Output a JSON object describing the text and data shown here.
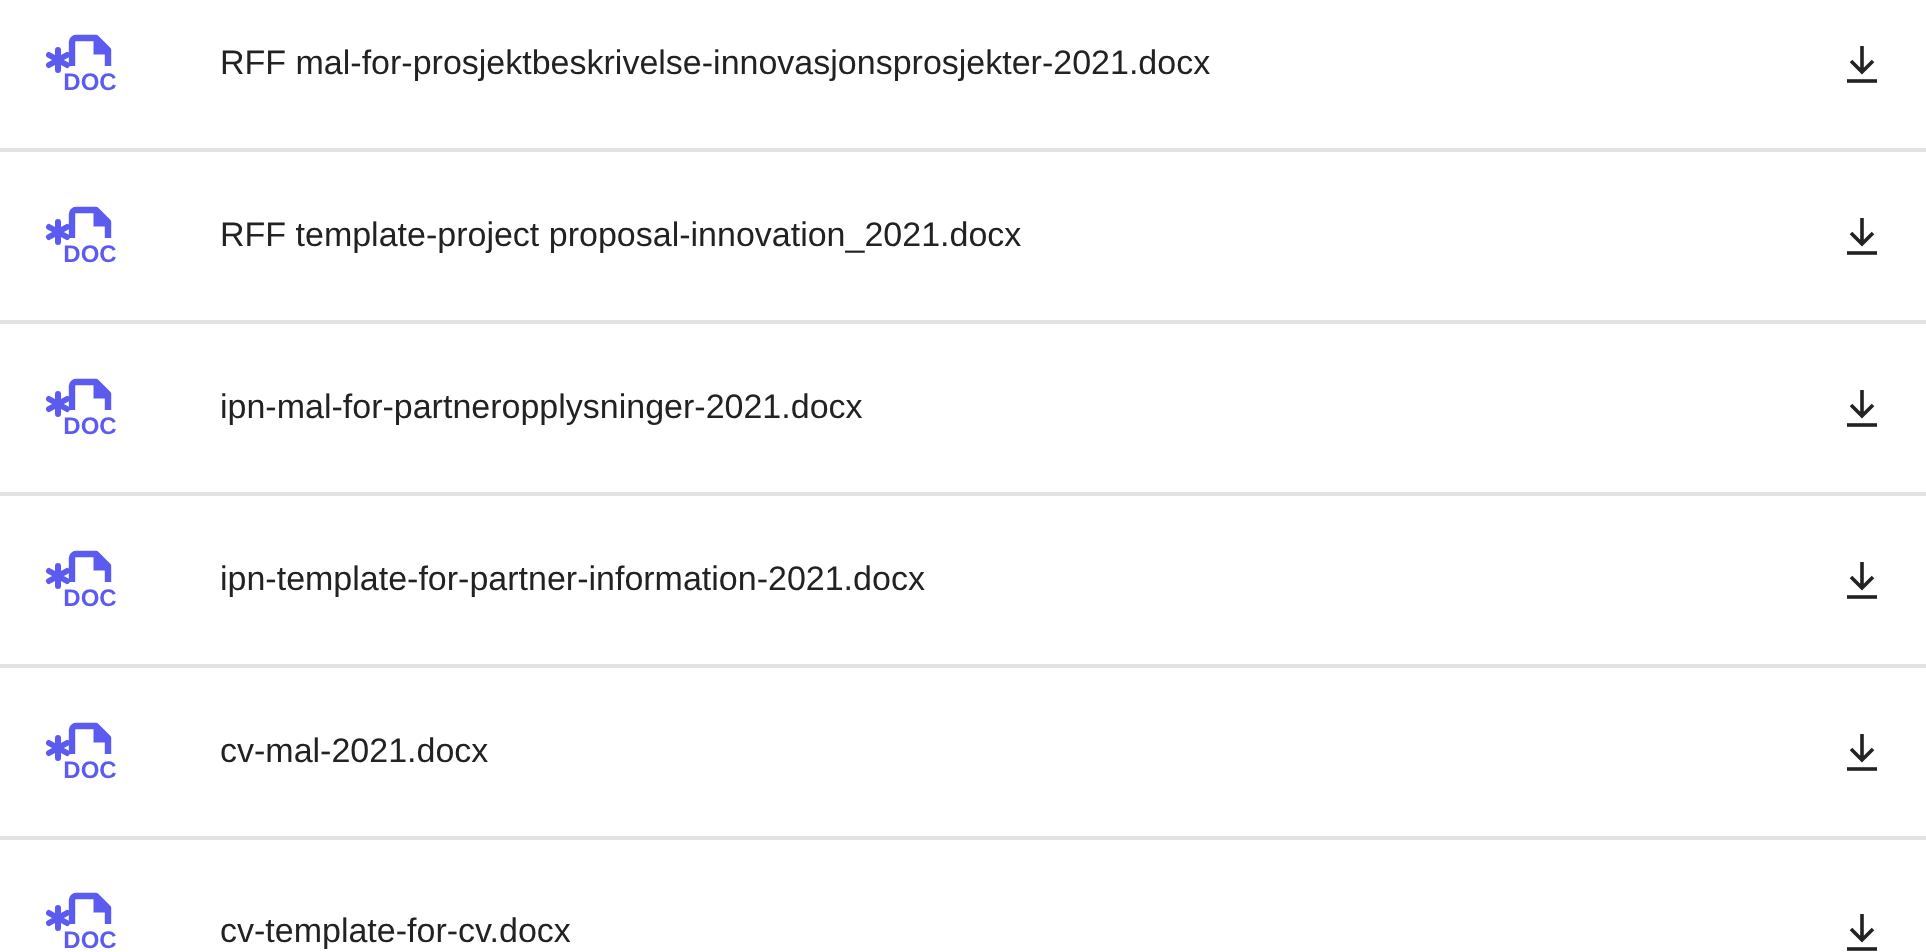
{
  "files": [
    {
      "name": "RFF mal-for-prosjektbeskrivelse-innovasjonsprosjekter-2021.docx",
      "type_label": "DOC"
    },
    {
      "name": "RFF template-project proposal-innovation_2021.docx",
      "type_label": "DOC"
    },
    {
      "name": "ipn-mal-for-partneropplysninger-2021.docx",
      "type_label": "DOC"
    },
    {
      "name": "ipn-template-for-partner-information-2021.docx",
      "type_label": "DOC"
    },
    {
      "name": "cv-mal-2021.docx",
      "type_label": "DOC"
    },
    {
      "name": "cv-template-for-cv.docx",
      "type_label": "DOC"
    }
  ]
}
